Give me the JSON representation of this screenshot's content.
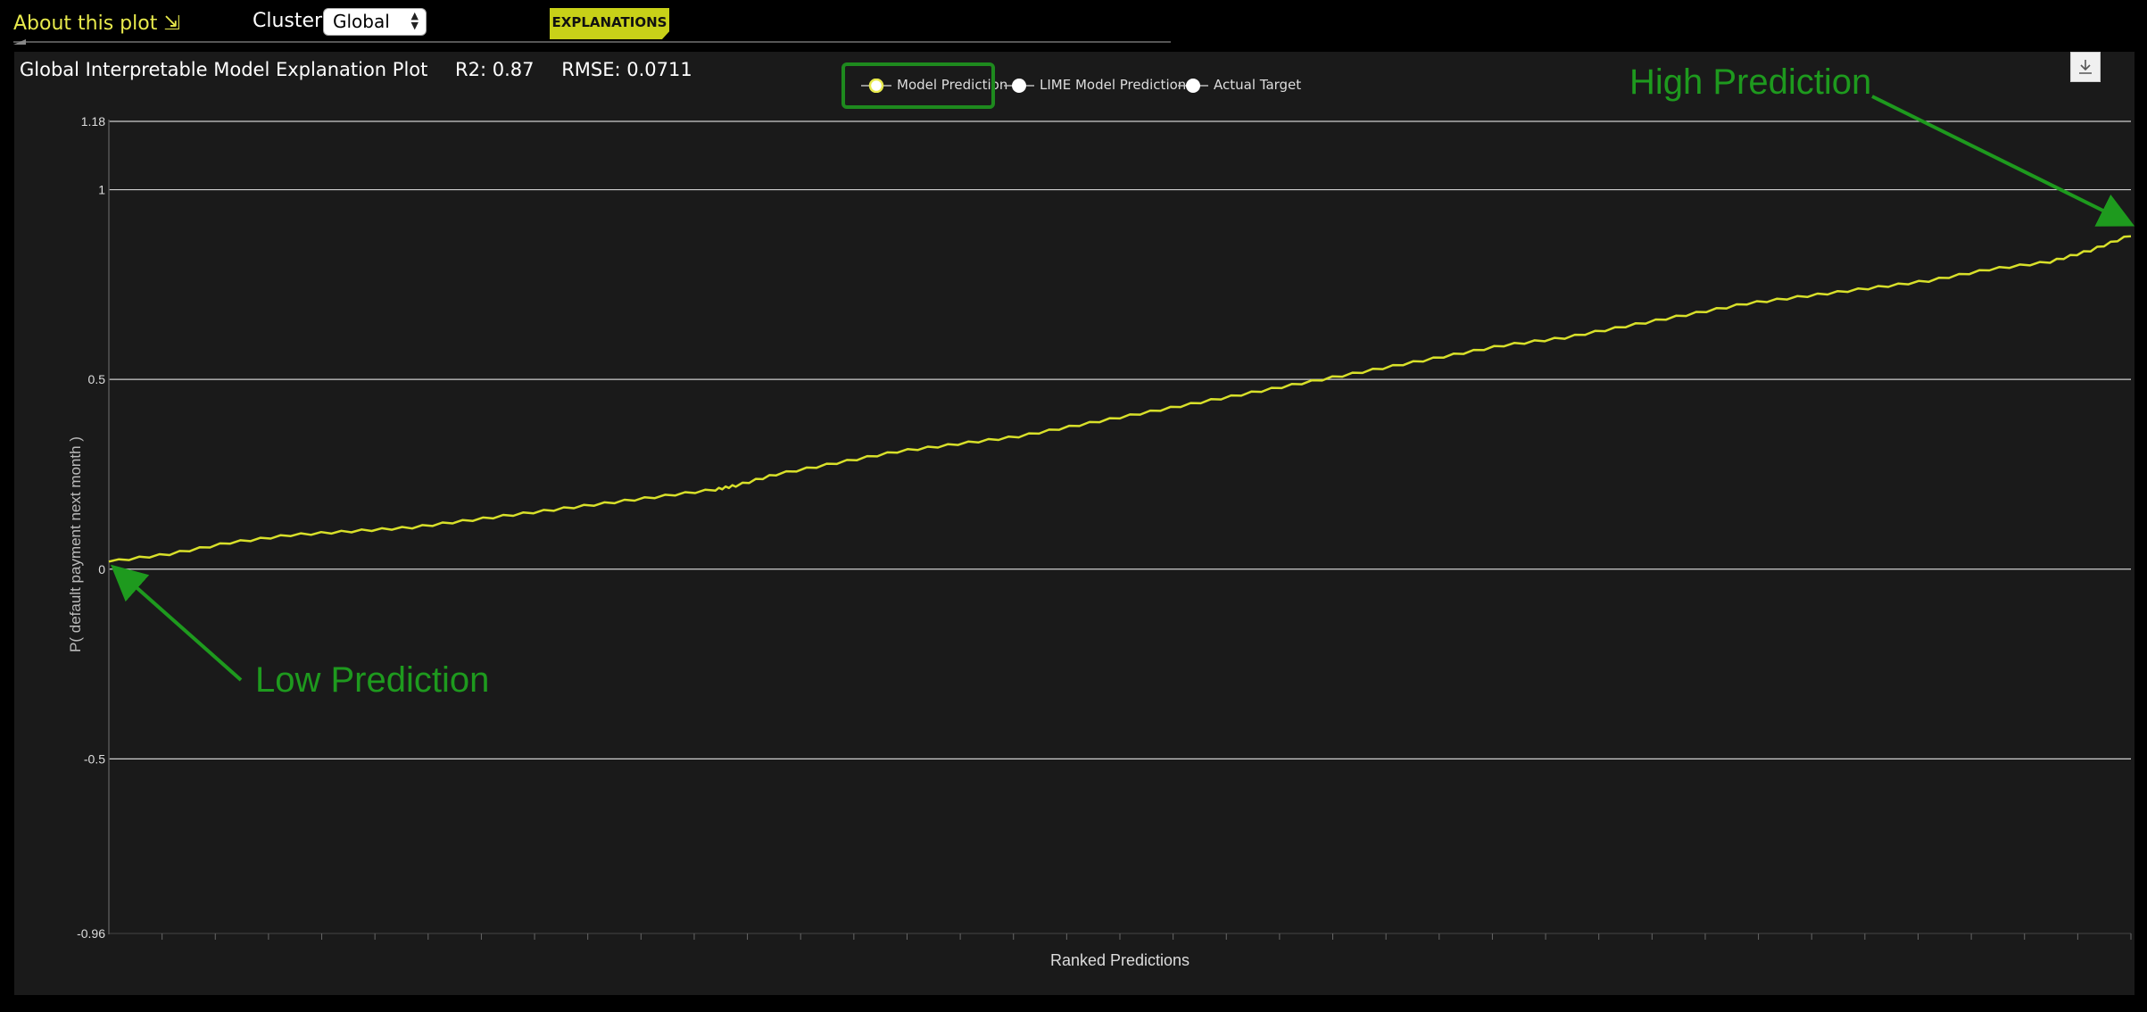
{
  "toolbar": {
    "about_label": "About this plot ⇲",
    "cluster_label": "Cluster:",
    "cluster_selected": "Global",
    "explanations_label": "EXPLANATIONS"
  },
  "plot": {
    "title": "Global Interpretable Model Explanation Plot",
    "r2": "R2: 0.87",
    "rmse": "RMSE: 0.0711",
    "download_icon": "download-icon"
  },
  "legend": {
    "items": [
      {
        "label": "Model Prediction",
        "marker_fill": "#ffffff",
        "marker_ring": "#e8ea4c",
        "highlighted": true
      },
      {
        "label": "LIME Model Prediction",
        "marker_fill": "#ffffff",
        "marker_ring": "#ffffff",
        "highlighted": false
      },
      {
        "label": "Actual Target",
        "marker_fill": "#ffffff",
        "marker_ring": "#ffffff",
        "highlighted": false
      }
    ]
  },
  "annotations": {
    "high": "High Prediction",
    "low": "Low Prediction",
    "color": "#1e9a1e"
  },
  "colors": {
    "accent": "#c8d118",
    "line": "#d8e02a",
    "background": "#1a1a1a"
  },
  "chart_data": {
    "type": "line",
    "xlabel": "Ranked Predictions",
    "ylabel": "P( default payment next month )",
    "ylim": [
      -0.96,
      1.18
    ],
    "yticks": [
      {
        "value": 1.18,
        "label": "1.18"
      },
      {
        "value": 1,
        "label": "1"
      },
      {
        "value": 0.5,
        "label": "0.5"
      },
      {
        "value": 0,
        "label": "0"
      },
      {
        "value": -0.5,
        "label": "-0.5"
      },
      {
        "value": -0.96,
        "label": "-0.96"
      }
    ],
    "grid": true,
    "series": [
      {
        "name": "Model Prediction",
        "x": [
          0,
          0.03,
          0.06,
          0.09,
          0.12,
          0.15,
          0.18,
          0.21,
          0.24,
          0.27,
          0.3,
          0.31,
          0.33,
          0.36,
          0.39,
          0.42,
          0.45,
          0.48,
          0.51,
          0.54,
          0.57,
          0.6,
          0.63,
          0.66,
          0.69,
          0.72,
          0.75,
          0.78,
          0.81,
          0.84,
          0.87,
          0.9,
          0.93,
          0.96,
          0.98,
          1.0
        ],
        "y": [
          0.02,
          0.04,
          0.07,
          0.09,
          0.1,
          0.11,
          0.13,
          0.15,
          0.17,
          0.19,
          0.21,
          0.22,
          0.25,
          0.28,
          0.31,
          0.33,
          0.35,
          0.38,
          0.41,
          0.44,
          0.47,
          0.5,
          0.53,
          0.56,
          0.59,
          0.61,
          0.64,
          0.67,
          0.7,
          0.72,
          0.74,
          0.76,
          0.79,
          0.81,
          0.84,
          0.88
        ]
      }
    ],
    "x_tick_count": 38
  }
}
